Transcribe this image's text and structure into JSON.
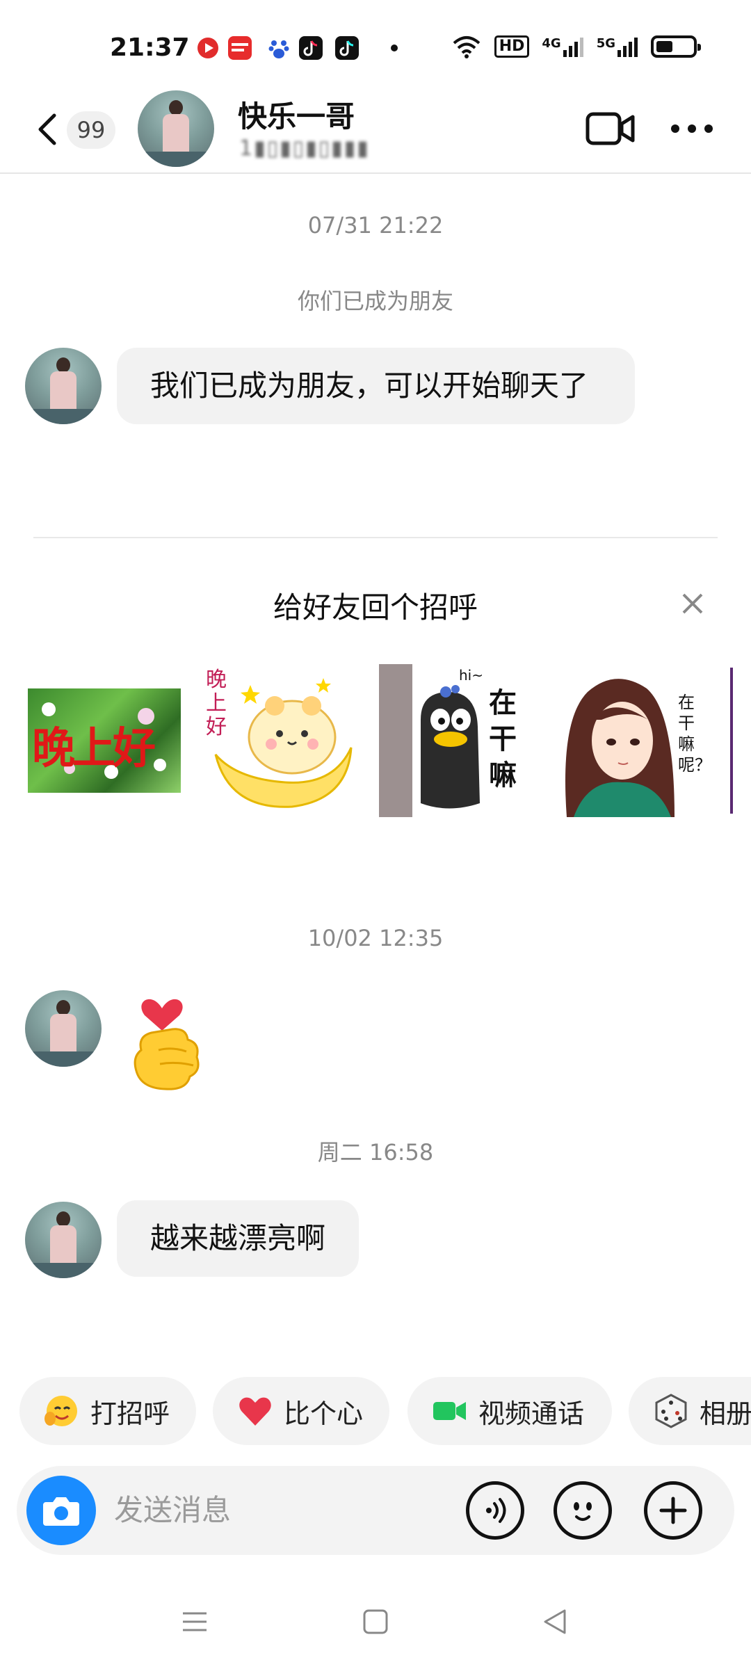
{
  "status_bar": {
    "time": "21:37",
    "app_icons": [
      "video-app-icon",
      "toutiao-icon",
      "baidu-icon",
      "tiktok-icon",
      "tiktok-icon"
    ],
    "hd_label": "HD",
    "net_1": "4G",
    "net_2": "5G",
    "battery_level": 0.4
  },
  "header": {
    "unread_count": "99",
    "contact_name": "快乐一哥",
    "subtitle": "1▮▯▮▯▮▯▮▮▮"
  },
  "messages": {
    "timestamp_1": "07/31 21:22",
    "system_notice": "你们已成为朋友",
    "bubble_1": "我们已成为朋友，可以开始聊天了",
    "timestamp_2": "10/02 12:35",
    "timestamp_3": "周二 16:58",
    "bubble_3": "越来越漂亮啊"
  },
  "greeting": {
    "title": "给好友回个招呼",
    "stickers": [
      {
        "name": "evening-flowers-sticker",
        "text": "晚上好"
      },
      {
        "name": "hamster-moon-sticker",
        "text": "晚上好"
      },
      {
        "name": "penguin-sticker",
        "text": "在干嘛",
        "hi": "hi~"
      },
      {
        "name": "girl-sticker",
        "text": "在干嘛呢？"
      }
    ]
  },
  "quick_actions": [
    {
      "label": "打招呼",
      "icon": "wave-emoji-icon"
    },
    {
      "label": "比个心",
      "icon": "heart-icon"
    },
    {
      "label": "视频通话",
      "icon": "video-camera-icon"
    },
    {
      "label": "相册",
      "icon": "dice-icon"
    }
  ],
  "input": {
    "placeholder": "发送消息"
  },
  "colors": {
    "accent_blue": "#1a8cff",
    "bubble_bg": "#f2f2f2",
    "video_green": "#22c55e",
    "heart_red": "#e8364b"
  }
}
